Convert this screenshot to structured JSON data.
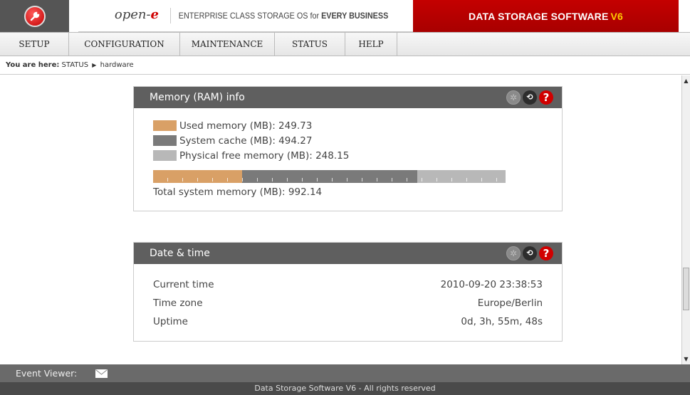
{
  "header": {
    "brand_prefix": "open-",
    "brand_suffix": "e",
    "tagline_prefix": "ENTERPRISE CLASS STORAGE OS for ",
    "tagline_bold": "EVERY BUSINESS",
    "product": "DATA STORAGE SOFTWARE",
    "product_version": "V6"
  },
  "nav": {
    "items": [
      {
        "label": "SETUP"
      },
      {
        "label": "CONFIGURATION"
      },
      {
        "label": "MAINTENANCE"
      },
      {
        "label": "STATUS"
      },
      {
        "label": "HELP"
      }
    ]
  },
  "breadcrumb": {
    "prefix": "You are here:",
    "section": "STATUS",
    "page": "hardware"
  },
  "memory": {
    "title": "Memory (RAM) info",
    "used_label": "Used memory (MB): 249.73",
    "cache_label": "System cache (MB): 494.27",
    "free_label": "Physical free memory (MB): 248.15",
    "total_label": "Total system memory (MB): 992.14",
    "used_mb": 249.73,
    "cache_mb": 494.27,
    "free_mb": 248.15,
    "total_mb": 992.14,
    "colors": {
      "used": "#d9a066",
      "cache": "#7a7a7a",
      "free": "#b8b8b8"
    }
  },
  "datetime": {
    "title": "Date & time",
    "rows": [
      {
        "label": "Current time",
        "value": "2010-09-20 23:38:53"
      },
      {
        "label": "Time zone",
        "value": "Europe/Berlin"
      },
      {
        "label": "Uptime",
        "value": "0d, 3h, 55m, 48s"
      }
    ]
  },
  "footer": {
    "event_viewer": "Event Viewer:",
    "copyright": "Data Storage Software V6 - All rights reserved"
  },
  "icons": {
    "logo": "wrench-icon",
    "settings": "gear-icon",
    "refresh": "refresh-icon",
    "help": "help-icon",
    "event": "envelope-icon"
  }
}
